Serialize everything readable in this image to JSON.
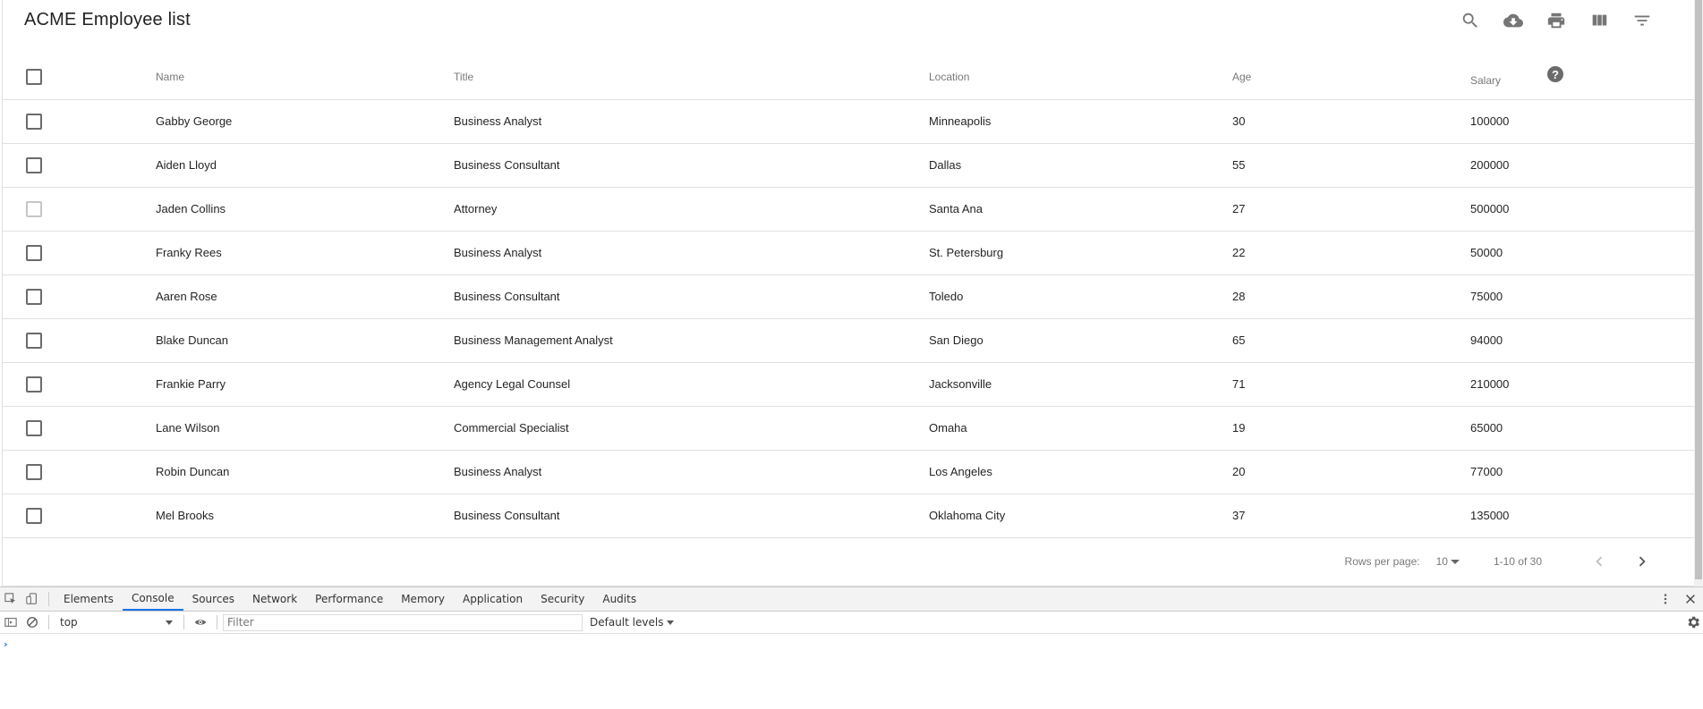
{
  "app": {
    "title": "ACME Employee list"
  },
  "toolbar": {
    "icons": [
      "search-icon",
      "cloud-download-icon",
      "print-icon",
      "view-column-icon",
      "filter-list-icon"
    ]
  },
  "table": {
    "columns": {
      "name": "Name",
      "title": "Title",
      "location": "Location",
      "age": "Age",
      "salary": "Salary",
      "salary_help": "?"
    },
    "rows": [
      {
        "name": "Gabby George",
        "title": "Business Analyst",
        "location": "Minneapolis",
        "age": "30",
        "salary": "100000"
      },
      {
        "name": "Aiden Lloyd",
        "title": "Business Consultant",
        "location": "Dallas",
        "age": "55",
        "salary": "200000"
      },
      {
        "name": "Jaden Collins",
        "title": "Attorney",
        "location": "Santa Ana",
        "age": "27",
        "salary": "500000"
      },
      {
        "name": "Franky Rees",
        "title": "Business Analyst",
        "location": "St. Petersburg",
        "age": "22",
        "salary": "50000"
      },
      {
        "name": "Aaren Rose",
        "title": "Business Consultant",
        "location": "Toledo",
        "age": "28",
        "salary": "75000"
      },
      {
        "name": "Blake Duncan",
        "title": "Business Management Analyst",
        "location": "San Diego",
        "age": "65",
        "salary": "94000"
      },
      {
        "name": "Frankie Parry",
        "title": "Agency Legal Counsel",
        "location": "Jacksonville",
        "age": "71",
        "salary": "210000"
      },
      {
        "name": "Lane Wilson",
        "title": "Commercial Specialist",
        "location": "Omaha",
        "age": "19",
        "salary": "65000"
      },
      {
        "name": "Robin Duncan",
        "title": "Business Analyst",
        "location": "Los Angeles",
        "age": "20",
        "salary": "77000"
      },
      {
        "name": "Mel Brooks",
        "title": "Business Consultant",
        "location": "Oklahoma City",
        "age": "37",
        "salary": "135000"
      }
    ]
  },
  "pagination": {
    "rows_per_page_label": "Rows per page:",
    "rows_per_page_value": "10",
    "range": "1-10 of 30"
  },
  "devtools": {
    "tabs": [
      "Elements",
      "Console",
      "Sources",
      "Network",
      "Performance",
      "Memory",
      "Application",
      "Security",
      "Audits"
    ],
    "active_tab": "Console",
    "context": "top",
    "filter_placeholder": "Filter",
    "levels": "Default levels",
    "prompt": "›"
  },
  "colors": {
    "accent": "#1a73e8",
    "icon": "#757575"
  }
}
